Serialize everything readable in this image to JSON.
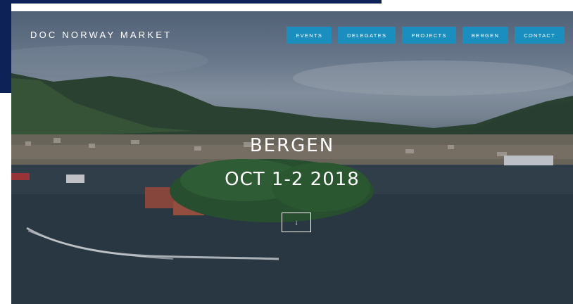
{
  "brand": {
    "title": "DOC NORWAY MARKET"
  },
  "nav": {
    "items": [
      {
        "label": "EVENTS"
      },
      {
        "label": "DELEGATES"
      },
      {
        "label": "PROJECTS"
      },
      {
        "label": "BERGEN"
      },
      {
        "label": "CONTACT"
      }
    ]
  },
  "hero": {
    "city": "BERGEN",
    "date": "OCT 1-2 2018",
    "scroll_icon": "arrow-down-icon",
    "scroll_glyph": "↓"
  },
  "colors": {
    "accent": "#1b8ec0",
    "frame": "#0d2357"
  }
}
